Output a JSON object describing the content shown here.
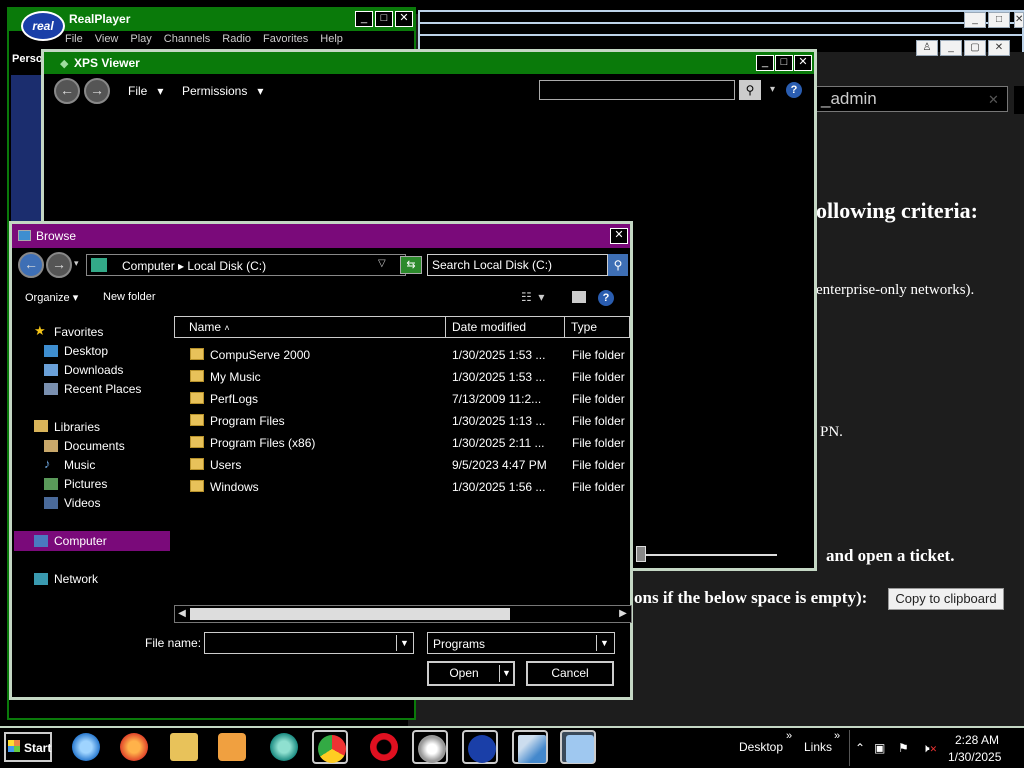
{
  "colors": {
    "xps_title": "#0a7a0a",
    "realplayer_title": "#0a7a0a",
    "browse_title": "#7a0a7a",
    "selection": "#7a0a7a",
    "folder": "#e8c25a",
    "frame": "#c4d7c4"
  },
  "background_page": {
    "admin_field": "_admin",
    "heading": "ollowing criteria:",
    "line_enterprise": "enterprise-only networks).",
    "line_pn": "PN.",
    "line_ticket": "and open a ticket.",
    "line_empty": "ons if the below space is empty):",
    "copy_button": "Copy to clipboard"
  },
  "realplayer": {
    "title": "RealPlayer",
    "logo": "real",
    "menu": [
      "File",
      "View",
      "Play",
      "Channels",
      "Radio",
      "Favorites",
      "Help"
    ],
    "side_label": "Perso"
  },
  "xps_viewer": {
    "title": "XPS Viewer",
    "menu_file": "File",
    "menu_permissions": "Permissions",
    "help_icon": "?"
  },
  "browse": {
    "title": "Browse",
    "breadcrumb": "Computer  ▸  Local Disk (C:)",
    "search_placeholder": "Search Local Disk (C:)",
    "organize": "Organize",
    "new_folder": "New folder",
    "nav": {
      "favorites": "Favorites",
      "desktop": "Desktop",
      "downloads": "Downloads",
      "recent_places": "Recent Places",
      "libraries": "Libraries",
      "documents": "Documents",
      "music": "Music",
      "pictures": "Pictures",
      "videos": "Videos",
      "computer": "Computer",
      "network": "Network"
    },
    "columns": {
      "name": "Name",
      "date_modified": "Date modified",
      "type": "Type"
    },
    "files": [
      {
        "name": "CompuServe 2000",
        "date": "1/30/2025 1:53 ...",
        "type": "File folder"
      },
      {
        "name": "My Music",
        "date": "1/30/2025 1:53 ...",
        "type": "File folder"
      },
      {
        "name": "PerfLogs",
        "date": "7/13/2009 11:2...",
        "type": "File folder"
      },
      {
        "name": "Program Files",
        "date": "1/30/2025 1:13 ...",
        "type": "File folder"
      },
      {
        "name": "Program Files (x86)",
        "date": "1/30/2025 2:11 ...",
        "type": "File folder"
      },
      {
        "name": "Users",
        "date": "9/5/2023 4:47 PM",
        "type": "File folder"
      },
      {
        "name": "Windows",
        "date": "1/30/2025 1:56 ...",
        "type": "File folder"
      }
    ],
    "file_name_label": "File name:",
    "file_name_value": "",
    "file_type": "Programs",
    "open_button": "Open",
    "cancel_button": "Cancel"
  },
  "taskbar": {
    "start": "Start",
    "desktop": "Desktop",
    "links": "Links",
    "time": "2:28 AM",
    "date": "1/30/2025",
    "icons": [
      "internet-explorer-icon",
      "firefox-icon",
      "file-explorer-icon",
      "media-player-icon",
      "teal-app-icon",
      "chrome-icon",
      "opera-icon",
      "settings-gear-icon",
      "realplayer-icon",
      "paper-plane-icon",
      "xps-viewer-icon"
    ]
  }
}
